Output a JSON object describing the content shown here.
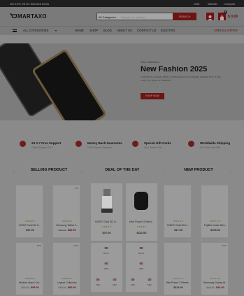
{
  "topbar": {
    "promo": "Get 15% Off On Selected Items",
    "currency": "USD",
    "wishlist": "Wishlist",
    "compare": "Compare"
  },
  "header": {
    "logo": "MARTAXO",
    "search_category": "All Categories",
    "search_placeholder": "Search our catalog",
    "search_button": "SEARCH",
    "cart_count": "0",
    "cart_total": "$ 0.00"
  },
  "nav": {
    "all_categories": "ALL CATEGORIES",
    "items": [
      "HOME",
      "SHOP",
      "BLOG",
      "ABOUT US",
      "CONTACT US",
      "ELECTRO"
    ],
    "special": "SPECIAL OFFER"
  },
  "hero": {
    "subtitle": "New Collection",
    "title": "New Fashion 2025",
    "description": "Contrary to popular belief, Lorem Ipsum is not simply random text. It has roots in a piece of classical",
    "button": "SHOP NOW"
  },
  "features": [
    {
      "title": "24 X 7 Free Support",
      "subtitle": "Online Support 24/7",
      "icon": "support-icon"
    },
    {
      "title": "Money Back Guarantee",
      "subtitle": "100% Secure Payment",
      "icon": "money-back-icon"
    },
    {
      "title": "Special Gift Cards",
      "subtitle": "Give Perfect Gift",
      "icon": "gift-icon"
    },
    {
      "title": "Worldwide Shipping",
      "subtitle": "On Order Over $99",
      "icon": "shipping-icon"
    }
  ],
  "sections": {
    "selling": "SELLING PRODUCT",
    "deal": "DEAL OF THE DAY",
    "new": "NEW PRODUCT"
  },
  "selling_products": [
    {
      "name": "IGENT Gold 3D Li...",
      "price": "$47.00",
      "old": "",
      "disc": ""
    },
    {
      "name": "Samsung Tablet 2...",
      "price": "$80.00",
      "old": "$89.00",
      "disc": "-5%"
    },
    {
      "name": "Modern Alarm Cal...",
      "price": "$59.00",
      "old": "$65.00",
      "disc": "-10%"
    },
    {
      "name": "Laptop Collection",
      "price": "$80.00",
      "old": "$89.00",
      "disc": "-10%"
    }
  ],
  "deal_products": [
    {
      "name": "IGENT Gold 3D Li...",
      "price": "$47.00",
      "old": ""
    },
    {
      "name": "Mini Power 3 Wirel...",
      "price": "$111.00",
      "old": ""
    }
  ],
  "timer_labels": [
    "DAYS",
    "HRS",
    "MIN",
    "SEC"
  ],
  "timer_values": [
    "00",
    "00",
    "00",
    "00"
  ],
  "new_products": [
    {
      "name": "IGENT Gold 3D Li...",
      "price": "$47.00",
      "old": "",
      "disc": ""
    },
    {
      "name": "Fujifilm Instax Mini...",
      "price": "$109.00",
      "old": "",
      "disc": ""
    },
    {
      "name": "Mini Power 3 Wirele...",
      "price": "$111.00",
      "old": "",
      "disc": ""
    },
    {
      "name": "Samsung Galaxy M...",
      "price": "$42.00",
      "old": "$45.00",
      "disc": "-10%"
    }
  ],
  "colors": {
    "accent": "#6b1414",
    "overlay": "#8a8a8a"
  }
}
